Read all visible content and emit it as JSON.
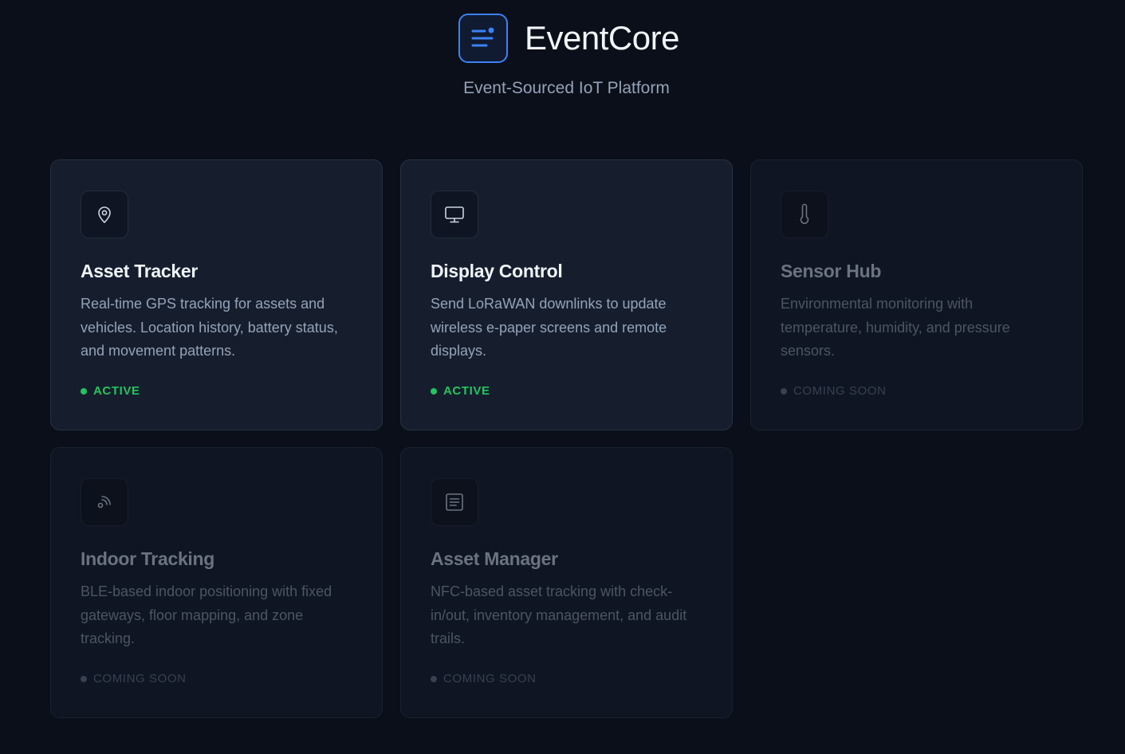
{
  "brand": {
    "name": "EventCore",
    "subtitle": "Event-Sourced IoT Platform",
    "accent": "#3b82f6"
  },
  "cards": [
    {
      "title": "Asset Tracker",
      "description": "Real-time GPS tracking for assets and vehicles. Location history, battery status, and movement patterns.",
      "status": "ACTIVE",
      "icon": "map-pin-icon"
    },
    {
      "title": "Display Control",
      "description": "Send LoRaWAN downlinks to update wireless e-paper screens and remote displays.",
      "status": "ACTIVE",
      "icon": "monitor-icon"
    },
    {
      "title": "Sensor Hub",
      "description": "Environmental monitoring with temperature, humidity, and pressure sensors.",
      "status": "COMING SOON",
      "icon": "thermometer-icon"
    },
    {
      "title": "Indoor Tracking",
      "description": "BLE-based indoor positioning with fixed gateways, floor mapping, and zone tracking.",
      "status": "COMING SOON",
      "icon": "signal-icon"
    },
    {
      "title": "Asset Manager",
      "description": "NFC-based asset tracking with check-in/out, inventory management, and audit trails.",
      "status": "COMING SOON",
      "icon": "document-icon"
    }
  ],
  "colors": {
    "background": "#0b0f19",
    "active_status": "#22c55e",
    "card": "#161e2e"
  }
}
